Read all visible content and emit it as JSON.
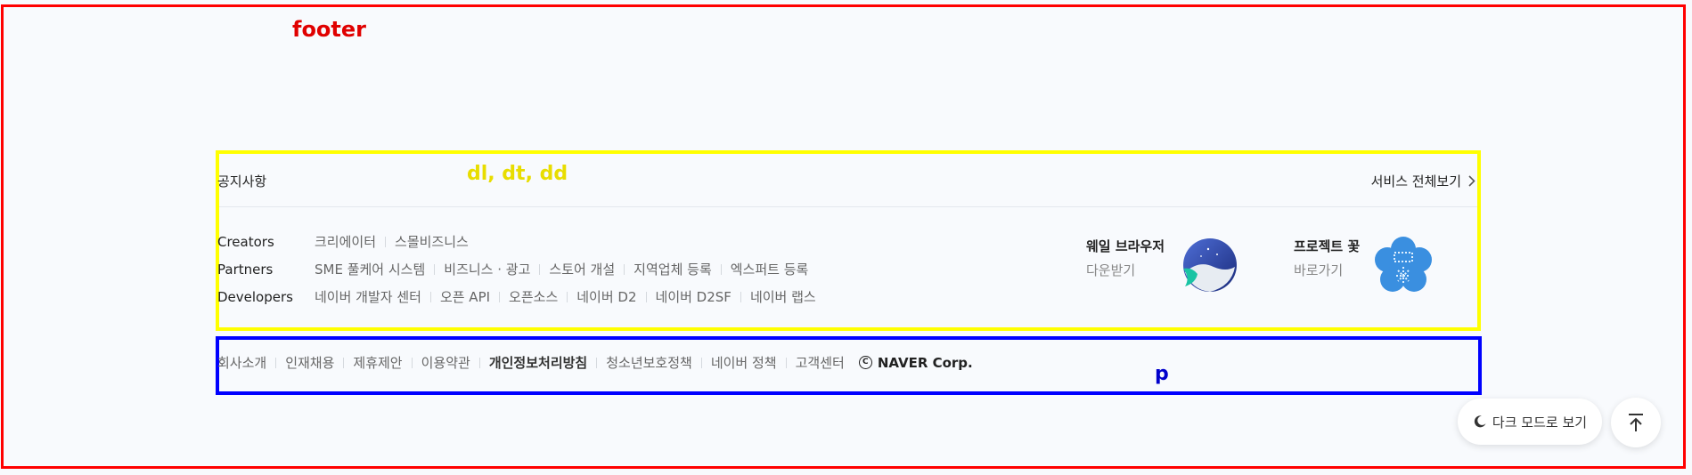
{
  "annotations": {
    "footer_tag": "footer",
    "dl_tag": "dl, dt, dd",
    "p_tag": "p"
  },
  "notice": {
    "label": "공지사항"
  },
  "service_all": {
    "label": "서비스 전체보기"
  },
  "groups": [
    {
      "title": "Creators",
      "items": [
        "크리에이터",
        "스몰비즈니스"
      ]
    },
    {
      "title": "Partners",
      "items": [
        "SME 풀케어 시스템",
        "비즈니스 · 광고",
        "스토어 개설",
        "지역업체 등록",
        "엑스퍼트 등록"
      ]
    },
    {
      "title": "Developers",
      "items": [
        "네이버 개발자 센터",
        "오픈 API",
        "오픈소스",
        "네이버 D2",
        "네이버 D2SF",
        "네이버 랩스"
      ]
    }
  ],
  "apps": {
    "whale": {
      "title": "웨일 브라우저",
      "sub": "다운받기",
      "icon": "whale-browser-icon"
    },
    "flower": {
      "title": "프로젝트 꽃",
      "sub": "바로가기",
      "icon": "project-flower-icon"
    }
  },
  "bottom_links": [
    "회사소개",
    "인재채용",
    "제휴제안",
    "이용약관",
    "개인정보처리방침",
    "청소년보호정책",
    "네이버 정책",
    "고객센터"
  ],
  "bottom_bold_index": 4,
  "corp": {
    "label": "NAVER Corp.",
    "icon": "copyright-icon"
  },
  "dark_mode": {
    "label": "다크 모드로 보기",
    "icon": "moon-icon"
  },
  "scroll_top": {
    "icon": "arrow-up-to-top-icon"
  },
  "colors": {
    "background": "#f8fafd",
    "footer_frame": "#ff0000",
    "dl_frame": "#ffff00",
    "p_frame": "#0000ff",
    "whale_teal": "#19c4a4",
    "flower_blue": "#3a8fe0"
  }
}
